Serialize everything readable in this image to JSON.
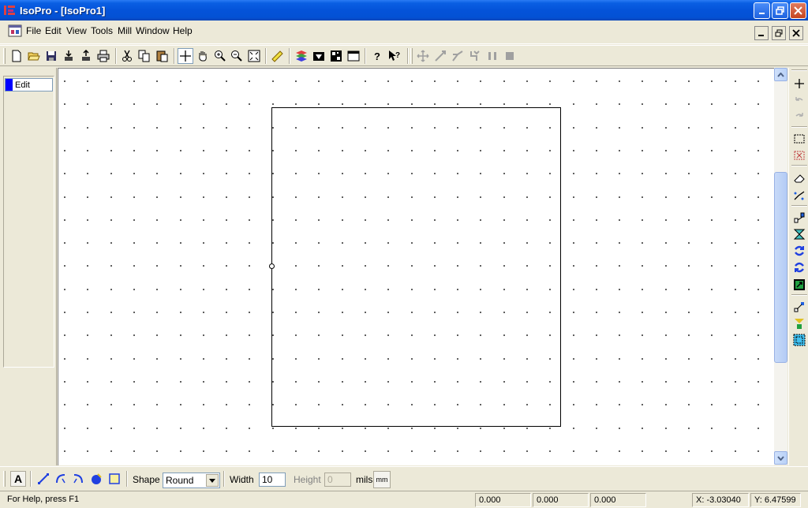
{
  "window": {
    "title": "IsoPro - [IsoPro1]"
  },
  "menu": {
    "items": [
      "File",
      "Edit",
      "View",
      "Tools",
      "Mill",
      "Window",
      "Help"
    ]
  },
  "toolbar": {
    "icons": [
      "new-file-icon",
      "open-folder-icon",
      "save-icon",
      "import-icon",
      "export-icon",
      "print-icon",
      "cut-icon",
      "copy-icon",
      "paste-icon",
      "crosshair-icon",
      "pan-hand-icon",
      "zoom-in-icon",
      "zoom-out-icon",
      "zoom-fit-icon",
      "measure-icon",
      "layers-icon",
      "layer-color-icon",
      "grid-pattern-icon",
      "window-icon",
      "help-icon",
      "context-help-icon",
      "move-icon",
      "line-icon",
      "route-icon",
      "step-icon",
      "pause-icon",
      "stop-icon"
    ]
  },
  "layers": {
    "items": [
      {
        "label": "Edit",
        "color": "#0000ff"
      }
    ]
  },
  "right_toolbar": {
    "icons": [
      "cross-icon",
      "undo-icon",
      "redo-icon",
      "select-rect-icon",
      "deselect-icon",
      "eraser-icon",
      "trace-icon",
      "node-icon",
      "flip-icon",
      "rotate-cw-icon",
      "rotate-ccw-icon",
      "group-icon",
      "connect-icon",
      "align-icon",
      "select-all-icon"
    ]
  },
  "bottom_toolbar": {
    "text_tool": "A",
    "shape_label": "Shape",
    "shape_value": "Round",
    "width_label": "Width",
    "width_value": "10",
    "height_label": "Height",
    "height_value": "0",
    "units_label": "mils",
    "units_button": "mm"
  },
  "status": {
    "help_text": "For Help, press F1",
    "pane1": "0.000",
    "pane2": "0.000",
    "pane3": "0.000",
    "x_coord": "X: -3.03040",
    "y_coord": "Y: 6.47599"
  },
  "colors": {
    "titlebar": "#0453d9",
    "canvas": "#ffffff",
    "grid_dot": "#000000",
    "layer_edit": "#0000ff"
  }
}
